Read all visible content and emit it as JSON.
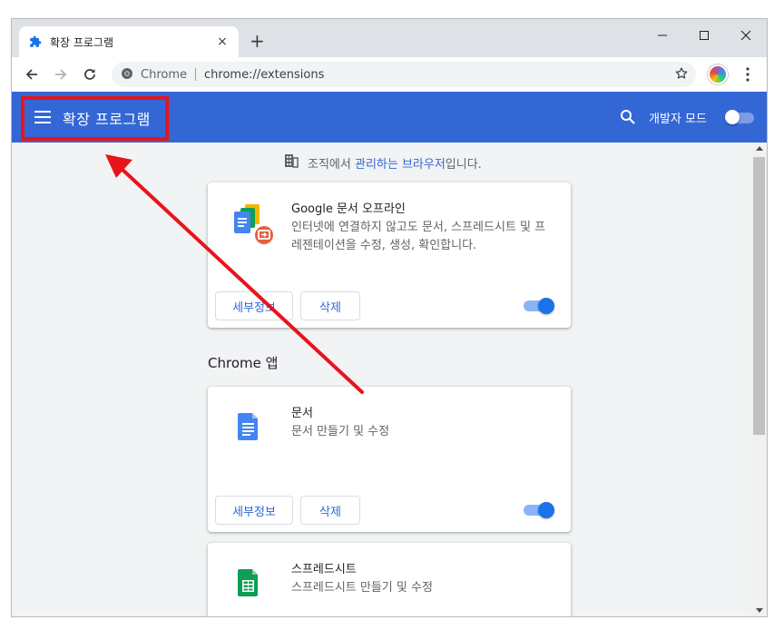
{
  "browser": {
    "tab_title": "확장 프로그램",
    "tab_close": "×",
    "new_tab": "+",
    "omnibox_site": "Chrome",
    "omnibox_url": "chrome://extensions"
  },
  "header": {
    "title": "확장 프로그램",
    "dev_mode_label": "개발자 모드",
    "dev_mode_on": false,
    "accent_color": "#3367d6",
    "highlight_color": "#e8141c"
  },
  "managed_notice": {
    "prefix": "조직에서 ",
    "link": "관리하는 브라우저",
    "suffix": "입니다."
  },
  "extensions": [
    {
      "name": "Google 문서 오프라인",
      "description": "인터넷에 연결하지 않고도 문서, 스프레드시트 및 프레젠테이션을 수정, 생성, 확인합니다.",
      "details_label": "세부정보",
      "remove_label": "삭제",
      "enabled": true,
      "icon": "docs-offline-icon"
    }
  ],
  "apps_section_title": "Chrome 앱",
  "apps": [
    {
      "name": "문서",
      "description": "문서 만들기 및 수정",
      "details_label": "세부정보",
      "remove_label": "삭제",
      "enabled": true,
      "icon": "google-docs-icon"
    },
    {
      "name": "스프레드시트",
      "description": "스프레드시트 만들기 및 수정",
      "icon": "google-sheets-icon"
    }
  ]
}
